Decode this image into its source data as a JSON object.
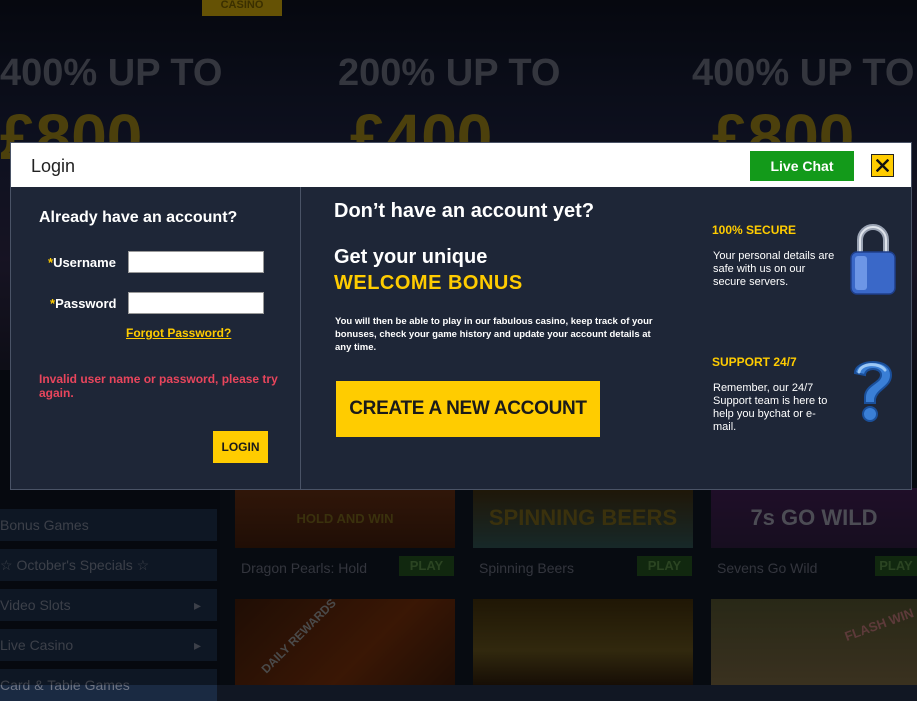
{
  "background": {
    "logo_tab": "CASINO",
    "promos": [
      {
        "headline": "400% UP TO",
        "amount": "£800"
      },
      {
        "headline": "200% UP TO",
        "amount": "£400"
      },
      {
        "headline": "400% UP TO",
        "amount": "£800"
      }
    ],
    "sidebar": {
      "items": [
        {
          "label": "Bonus Games",
          "arrow": ""
        },
        {
          "label": "☆ October's Specials ☆",
          "arrow": ""
        },
        {
          "label": "Video Slots",
          "arrow": "▸"
        },
        {
          "label": "Live Casino",
          "arrow": "▸"
        },
        {
          "label": "Card & Table Games",
          "arrow": ""
        }
      ]
    },
    "games": [
      {
        "tile_text": "HOLD AND WIN",
        "name": "Dragon Pearls: Hold",
        "play": "PLAY"
      },
      {
        "tile_text": "SPINNING BEERS",
        "name": "Spinning Beers",
        "play": "PLAY"
      },
      {
        "tile_text": "7s GO WILD",
        "name": "Sevens Go Wild",
        "play": "PLAY"
      }
    ],
    "bottom_tiles": [
      "DAILY REWARDS",
      "",
      "FLASH WIN"
    ]
  },
  "modal": {
    "title": "Login",
    "live_chat_label": "Live Chat",
    "close_icon": "close-icon",
    "login": {
      "heading": "Already have an account?",
      "required_mark": "*",
      "username_label": "Username",
      "username_value": "",
      "password_label": "Password",
      "password_value": "",
      "forgot_label": "Forgot Password?",
      "error_text": "Invalid user name or password, please try again.",
      "login_button": "LOGIN"
    },
    "register": {
      "heading": "Don’t have an account yet?",
      "subheading": "Get your unique",
      "bonus": "WELCOME BONUS",
      "description": "You will then be able to play in our fabulous casino, keep track of your bonuses, check your game history and update your account details at any time.",
      "create_button": "CREATE A NEW ACCOUNT"
    },
    "features": [
      {
        "title": "100% SECURE",
        "text": "Your personal details are safe with us on our secure servers.",
        "icon": "padlock-icon"
      },
      {
        "title": "SUPPORT 24/7",
        "text": "Remember, our 24/7 Support team is here to help you bychat or e-mail.",
        "icon": "question-mark-icon"
      }
    ],
    "colors": {
      "accent": "#ffcc00",
      "panel": "#1e2637",
      "live_chat": "#139a1a",
      "error": "#e8455c"
    }
  }
}
